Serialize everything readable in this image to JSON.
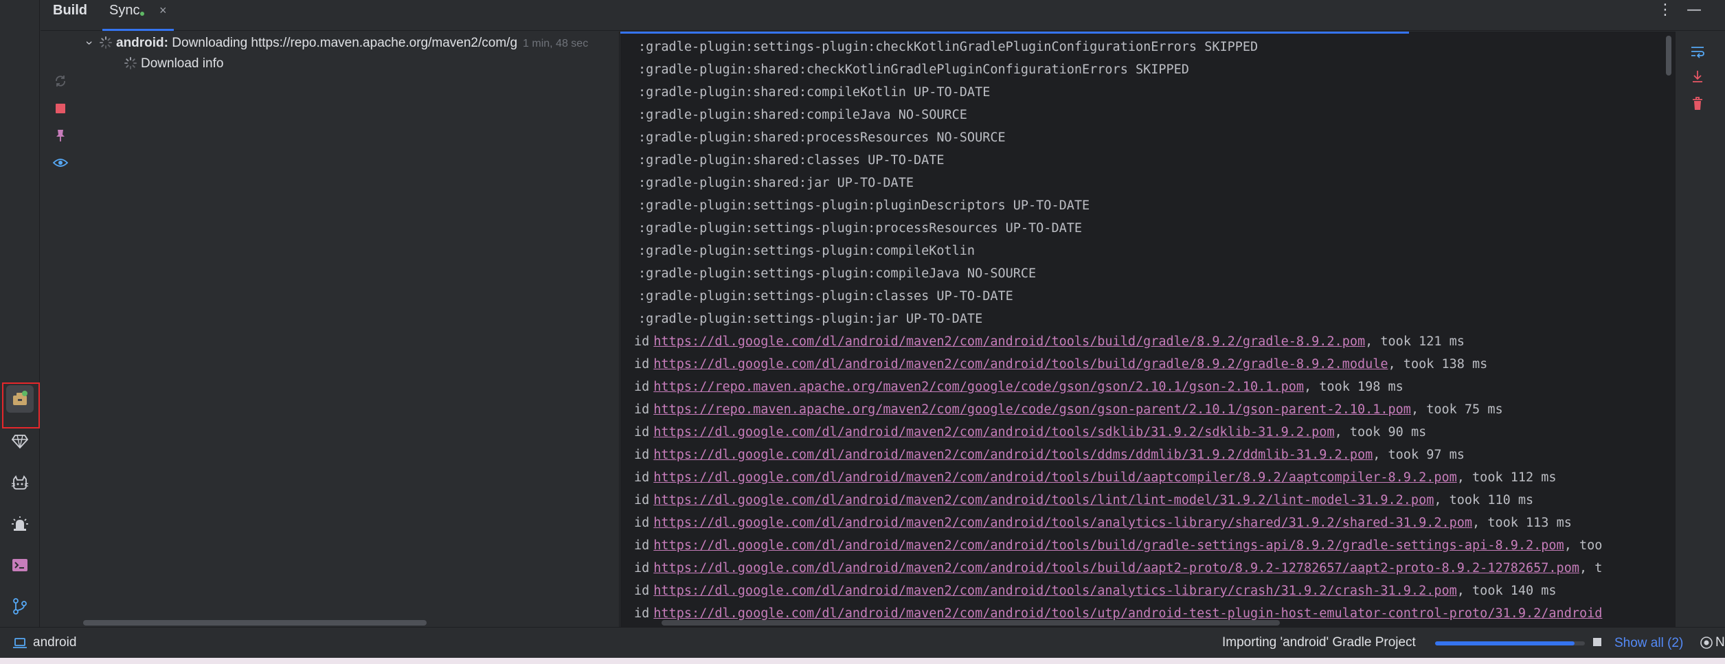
{
  "header": {
    "tab_build": "Build",
    "tab_sync": "Sync",
    "tab_close": "×",
    "more": "⋮",
    "minimize": "—"
  },
  "tree": {
    "root": {
      "name": "android:",
      "message": "Downloading https://repo.maven.apache.org/maven2/com/g",
      "time": "1 min, 48 sec"
    },
    "child": {
      "label": "Download info"
    }
  },
  "console": {
    "task_lines": [
      ":gradle-plugin:settings-plugin:checkKotlinGradlePluginConfigurationErrors SKIPPED",
      ":gradle-plugin:shared:checkKotlinGradlePluginConfigurationErrors SKIPPED",
      ":gradle-plugin:shared:compileKotlin UP-TO-DATE",
      ":gradle-plugin:shared:compileJava NO-SOURCE",
      ":gradle-plugin:shared:processResources NO-SOURCE",
      ":gradle-plugin:shared:classes UP-TO-DATE",
      ":gradle-plugin:shared:jar UP-TO-DATE",
      ":gradle-plugin:settings-plugin:pluginDescriptors UP-TO-DATE",
      ":gradle-plugin:settings-plugin:processResources UP-TO-DATE",
      ":gradle-plugin:settings-plugin:compileKotlin",
      ":gradle-plugin:settings-plugin:compileJava NO-SOURCE",
      ":gradle-plugin:settings-plugin:classes UP-TO-DATE",
      ":gradle-plugin:settings-plugin:jar UP-TO-DATE"
    ],
    "download_lines": [
      {
        "prefix": "id",
        "url": "https://dl.google.com/dl/android/maven2/com/android/tools/build/gradle/8.9.2/gradle-8.9.2.pom",
        "suffix": ", took 121 ms"
      },
      {
        "prefix": "id",
        "url": "https://dl.google.com/dl/android/maven2/com/android/tools/build/gradle/8.9.2/gradle-8.9.2.module",
        "suffix": ", took 138 ms"
      },
      {
        "prefix": "id",
        "url": "https://repo.maven.apache.org/maven2/com/google/code/gson/gson/2.10.1/gson-2.10.1.pom",
        "suffix": ", took 198 ms"
      },
      {
        "prefix": "id",
        "url": "https://repo.maven.apache.org/maven2/com/google/code/gson/gson-parent/2.10.1/gson-parent-2.10.1.pom",
        "suffix": ", took 75 ms"
      },
      {
        "prefix": "id",
        "url": "https://dl.google.com/dl/android/maven2/com/android/tools/sdklib/31.9.2/sdklib-31.9.2.pom",
        "suffix": ", took 90 ms"
      },
      {
        "prefix": "id",
        "url": "https://dl.google.com/dl/android/maven2/com/android/tools/ddms/ddmlib/31.9.2/ddmlib-31.9.2.pom",
        "suffix": ", took 97 ms"
      },
      {
        "prefix": "id",
        "url": "https://dl.google.com/dl/android/maven2/com/android/tools/build/aaptcompiler/8.9.2/aaptcompiler-8.9.2.pom",
        "suffix": ", took 112 ms"
      },
      {
        "prefix": "id",
        "url": "https://dl.google.com/dl/android/maven2/com/android/tools/lint/lint-model/31.9.2/lint-model-31.9.2.pom",
        "suffix": ", took 110 ms"
      },
      {
        "prefix": "id",
        "url": "https://dl.google.com/dl/android/maven2/com/android/tools/analytics-library/shared/31.9.2/shared-31.9.2.pom",
        "suffix": ", took 113 ms"
      },
      {
        "prefix": "id",
        "url": "https://dl.google.com/dl/android/maven2/com/android/tools/build/gradle-settings-api/8.9.2/gradle-settings-api-8.9.2.pom",
        "suffix": ", too"
      },
      {
        "prefix": "id",
        "url": "https://dl.google.com/dl/android/maven2/com/android/tools/build/aapt2-proto/8.9.2-12782657/aapt2-proto-8.9.2-12782657.pom",
        "suffix": ", t"
      },
      {
        "prefix": "id",
        "url": "https://dl.google.com/dl/android/maven2/com/android/tools/analytics-library/crash/31.9.2/crash-31.9.2.pom",
        "suffix": ", took 140 ms"
      },
      {
        "prefix": "id",
        "url": "https://dl.google.com/dl/android/maven2/com/android/tools/utp/android-test-plugin-host-emulator-control-proto/31.9.2/android",
        "suffix": ""
      }
    ]
  },
  "status_bar": {
    "project": "android",
    "task": "Importing 'android' Gradle Project",
    "progress": 0.93,
    "show_all": "Show all (2)",
    "cut_text": "N"
  },
  "colors": {
    "link": "#C77DBB",
    "accent": "#3574F0",
    "highlight_box": "#E5272B"
  }
}
